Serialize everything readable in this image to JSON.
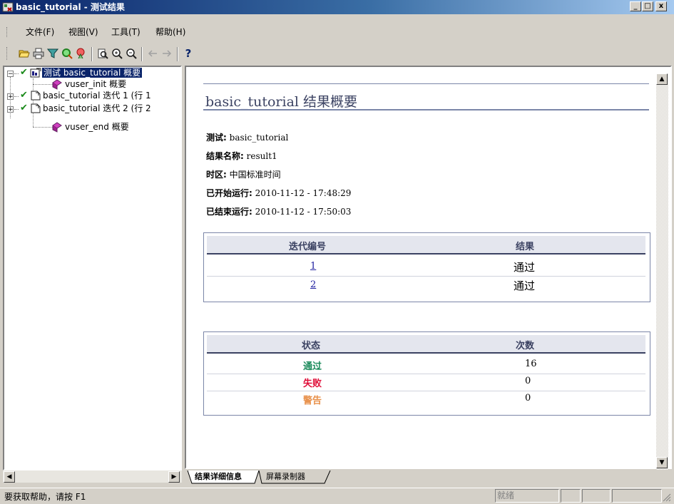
{
  "window": {
    "title": "basic_tutorial - 测试结果"
  },
  "caption_buttons": {
    "minimize": "_",
    "maximize": "□",
    "close": "x"
  },
  "menu": [
    {
      "label": "文件(F)"
    },
    {
      "label": "视图(V)"
    },
    {
      "label": "工具(T)"
    },
    {
      "label": "帮助(H)"
    }
  ],
  "toolbar": {
    "icons": [
      "open-folder-icon",
      "print-icon",
      "filter-icon",
      "find-icon",
      "find-person-icon",
      "preview-icon",
      "zoom-in-icon",
      "zoom-out-icon",
      "back-arrow-icon",
      "forward-arrow-icon",
      "help-icon"
    ],
    "help_label": "?"
  },
  "tree": {
    "nodes": [
      {
        "label": "测试 basic_tutorial 概要",
        "selected": true
      },
      {
        "label": "vuser_init 概要"
      },
      {
        "label": "basic_tutorial 迭代 1 (行 1"
      },
      {
        "label": "basic_tutorial 迭代 2 (行 2"
      },
      {
        "label": "vuser_end 概要"
      }
    ]
  },
  "summary": {
    "heading": "basic_tutorial 结果概要",
    "fields": [
      {
        "label": "测试:",
        "value": "basic_tutorial"
      },
      {
        "label": "结果名称:",
        "value": "result1"
      },
      {
        "label": "时区:",
        "value": "中国标准时间"
      },
      {
        "label": "已开始运行:",
        "value": "2010-11-12 - 17:48:29"
      },
      {
        "label": "已结束运行:",
        "value": "2010-11-12 - 17:50:03"
      }
    ],
    "iterations_table": {
      "headers": [
        "迭代编号",
        "结果"
      ],
      "rows": [
        {
          "id": "1",
          "result": "通过"
        },
        {
          "id": "2",
          "result": "通过"
        }
      ]
    },
    "status_table": {
      "headers": [
        "状态",
        "次数"
      ],
      "rows": [
        {
          "status": "通过",
          "count": "16",
          "color": "#1a8a5a"
        },
        {
          "status": "失败",
          "count": "0",
          "color": "#e0103a"
        },
        {
          "status": "警告",
          "count": "0",
          "color": "#e8904a"
        }
      ]
    }
  },
  "tabs": [
    {
      "label": "结果详细信息",
      "active": true
    },
    {
      "label": "屏幕录制器",
      "active": false
    }
  ],
  "statusbar": {
    "message": "要获取帮助，请按 F1",
    "pane": "就绪"
  }
}
